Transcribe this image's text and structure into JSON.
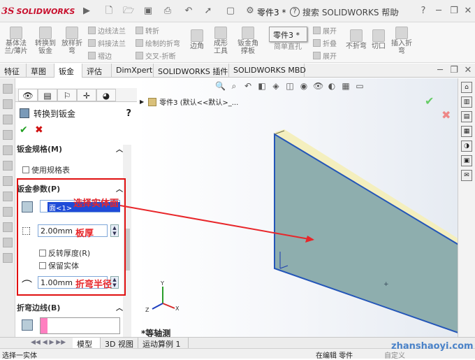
{
  "app": {
    "brand": "SOLIDWORKS",
    "doc_title": "零件3 *",
    "search_placeholder": "搜索 SOLIDWORKS 帮助",
    "menu_label": "零件"
  },
  "ribbon": {
    "buttons": [
      {
        "label": "基体法兰/薄片"
      },
      {
        "label": "转换到钣金"
      },
      {
        "label": "放样折弯"
      },
      {
        "label": "边角"
      },
      {
        "label": "成形工具"
      },
      {
        "label": "钣金角撑板"
      },
      {
        "label": "不折弯"
      },
      {
        "label": "切口"
      },
      {
        "label": "插入折弯"
      }
    ],
    "small": [
      "边线法兰",
      "斜接法兰",
      "褶边",
      "转折",
      "绘制的折弯",
      "交叉-折断",
      "展开",
      "折叠",
      "展开"
    ],
    "truncated": [
      "简单直孔"
    ]
  },
  "tabs": [
    "特征",
    "草图",
    "钣金",
    "评估",
    "DimXpert",
    "SOLIDWORKS 插件",
    "SOLIDWORKS MBD"
  ],
  "active_tab": "钣金",
  "property_manager": {
    "title": "转换到钣金",
    "help": "?",
    "ok": "✔",
    "cancel": "✖",
    "sections": {
      "gauge": {
        "title": "钣金规格(M)",
        "use_table": "使用规格表"
      },
      "params": {
        "title": "钣金参数(P)",
        "face_value": "面<1>",
        "thickness": "2.00mm",
        "reverse": "反转厚度(R)",
        "keep_body": "保留实体",
        "radius": "1.00mm"
      },
      "bend_edges": {
        "title": "折弯边线(B)"
      }
    }
  },
  "annotations": {
    "select_face": "选择实体面",
    "thickness": "板厚",
    "radius": "折弯半径"
  },
  "tree": {
    "root": "零件3 (默认<<默认>_..."
  },
  "view_label": "*等轴测",
  "bottom_tabs": [
    "模型",
    "3D 视图",
    "运动算例 1"
  ],
  "status": {
    "left": "选择一实体",
    "editing": "在编辑 零件",
    "custom": "自定义"
  },
  "watermark": "zhanshaoyi.com",
  "colors": {
    "accent_red": "#e01010",
    "face_fill": "#8eaeae",
    "edge_blue": "#2456b8",
    "plate_top": "#f4efbe"
  }
}
